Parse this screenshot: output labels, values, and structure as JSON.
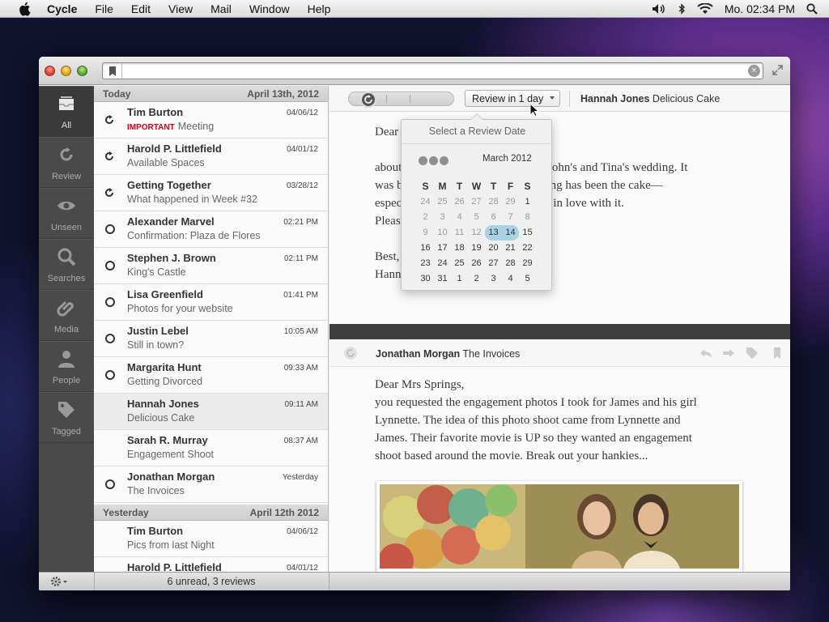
{
  "menubar": {
    "app_name": "Cycle",
    "items": [
      "File",
      "Edit",
      "View",
      "Mail",
      "Window",
      "Help"
    ],
    "clock": "Mo. 02:34 PM"
  },
  "sidebar": {
    "items": [
      {
        "label": "All",
        "icon": "inbox-icon",
        "active": true
      },
      {
        "label": "Review",
        "icon": "review-icon"
      },
      {
        "label": "Unseen",
        "icon": "eye-icon"
      },
      {
        "label": "Searches",
        "icon": "search-icon"
      },
      {
        "label": "Media",
        "icon": "paperclip-icon"
      },
      {
        "label": "People",
        "icon": "person-icon"
      },
      {
        "label": "Tagged",
        "icon": "tag-icon"
      }
    ]
  },
  "list": {
    "today_label": "Today",
    "today_date": "April 13th, 2012",
    "yesterday_label": "Yesterday",
    "yesterday_date": "April 12th 2012",
    "rows": [
      {
        "name": "Tim Burton",
        "flag": "IMPORTANT",
        "subject": "Meeting",
        "date": "04/06/12",
        "status": "review"
      },
      {
        "name": "Harold P. Littlefield",
        "subject": "Available Spaces",
        "date": "04/01/12",
        "status": "review"
      },
      {
        "name": "Getting Together",
        "subject": "What happened in Week #32",
        "date": "03/28/12",
        "status": "review"
      },
      {
        "name": "Alexander Marvel",
        "subject": "Confirmation: Plaza de Flores",
        "date": "02:21 PM",
        "status": "unread"
      },
      {
        "name": "Stephen J. Brown",
        "subject": "King's Castle",
        "date": "02:11 PM",
        "status": "unread"
      },
      {
        "name": "Lisa Greenfield",
        "subject": "Photos for your website",
        "date": "01:41 PM",
        "status": "unread"
      },
      {
        "name": "Justin Lebel",
        "subject": "Still in town?",
        "date": "10:05 AM",
        "status": "unread"
      },
      {
        "name": "Margarita Hunt",
        "subject": "Getting Divorced",
        "date": "09:33 AM",
        "status": "unread"
      },
      {
        "name": "Hannah Jones",
        "subject": "Delicious Cake",
        "date": "09:11 AM",
        "status": "none",
        "selected": true
      },
      {
        "name": "Sarah R. Murray",
        "subject": "Engagement Shoot",
        "date": "08:37 AM",
        "status": "none"
      },
      {
        "name": "Jonathan Morgan",
        "subject": "The Invoices",
        "date": "Yesterday",
        "status": "unread"
      }
    ],
    "yesterday_rows": [
      {
        "name": "Tim Burton",
        "subject": "Pics from last Night",
        "date": "04/06/12"
      },
      {
        "name": "Harold P. Littlefield",
        "subject": "",
        "date": "04/01/12"
      }
    ]
  },
  "toolbar": {
    "review_button": "Review in 1 day",
    "sender": "Hannah Jones",
    "subject": "Delicious Cake"
  },
  "message1": {
    "lines": [
      "Dear Ms. Mi",
      "",
      "about two years ago we've been on John's and Tina's wedding. It",
      "was beautiful. B                    best thing has been the cake—",
      "especially if                              y fell in love with it.",
      "Please, can",
      "",
      "Best,",
      "Hannah"
    ]
  },
  "popup": {
    "title": "Select a Review Date",
    "month": "March 2012",
    "weekdays": [
      "S",
      "M",
      "T",
      "W",
      "T",
      "F",
      "S"
    ],
    "weeks": [
      [
        "24",
        "25",
        "26",
        "27",
        "28",
        "29",
        "1"
      ],
      [
        "2",
        "3",
        "4",
        "5",
        "6",
        "7",
        "8"
      ],
      [
        "9",
        "10",
        "11",
        "12",
        "13",
        "14",
        "15"
      ],
      [
        "16",
        "17",
        "18",
        "19",
        "20",
        "21",
        "22"
      ],
      [
        "23",
        "24",
        "25",
        "26",
        "27",
        "28",
        "29"
      ],
      [
        "30",
        "31",
        "1",
        "2",
        "3",
        "4",
        "5"
      ]
    ]
  },
  "message2": {
    "sender": "Jonathan Morgan",
    "subject": "The Invoices",
    "lines": [
      "Dear Mrs Springs,",
      "you requested the engagement photos I took for James and his girl",
      "Lynnette. The idea of this photo shoot came from Lynnette and",
      "James. Their favorite movie is UP so they wanted an engagement",
      "shoot based around the movie. Break out your hankies..."
    ]
  },
  "status": {
    "text": "6 unread, 3 reviews"
  },
  "colors": {
    "important": "#d0021b",
    "highlight": "#a9d3e5",
    "sidebar": "#4a4a4a"
  }
}
